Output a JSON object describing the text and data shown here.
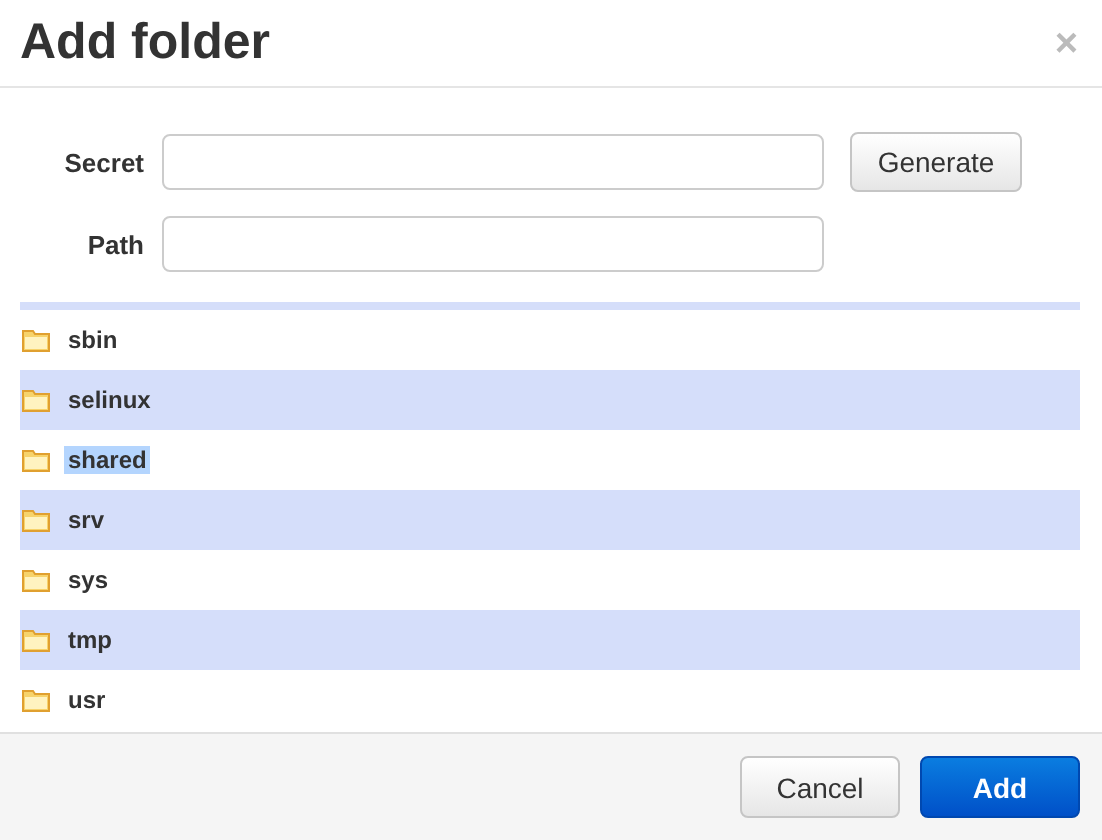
{
  "dialog": {
    "title": "Add folder",
    "close": "×"
  },
  "fields": [
    {
      "label": "Secret"
    },
    {
      "label": "Path"
    }
  ],
  "generate_button": "Generate",
  "folders": [
    {
      "name": "sbin",
      "highlighted": false
    },
    {
      "name": "selinux",
      "highlighted": false
    },
    {
      "name": "shared",
      "highlighted": true
    },
    {
      "name": "srv",
      "highlighted": false
    },
    {
      "name": "sys",
      "highlighted": false
    },
    {
      "name": "tmp",
      "highlighted": false
    },
    {
      "name": "usr",
      "highlighted": false
    }
  ],
  "buttons": [
    {
      "label": "Cancel",
      "kind": "secondary"
    },
    {
      "label": "Add",
      "kind": "primary"
    }
  ]
}
